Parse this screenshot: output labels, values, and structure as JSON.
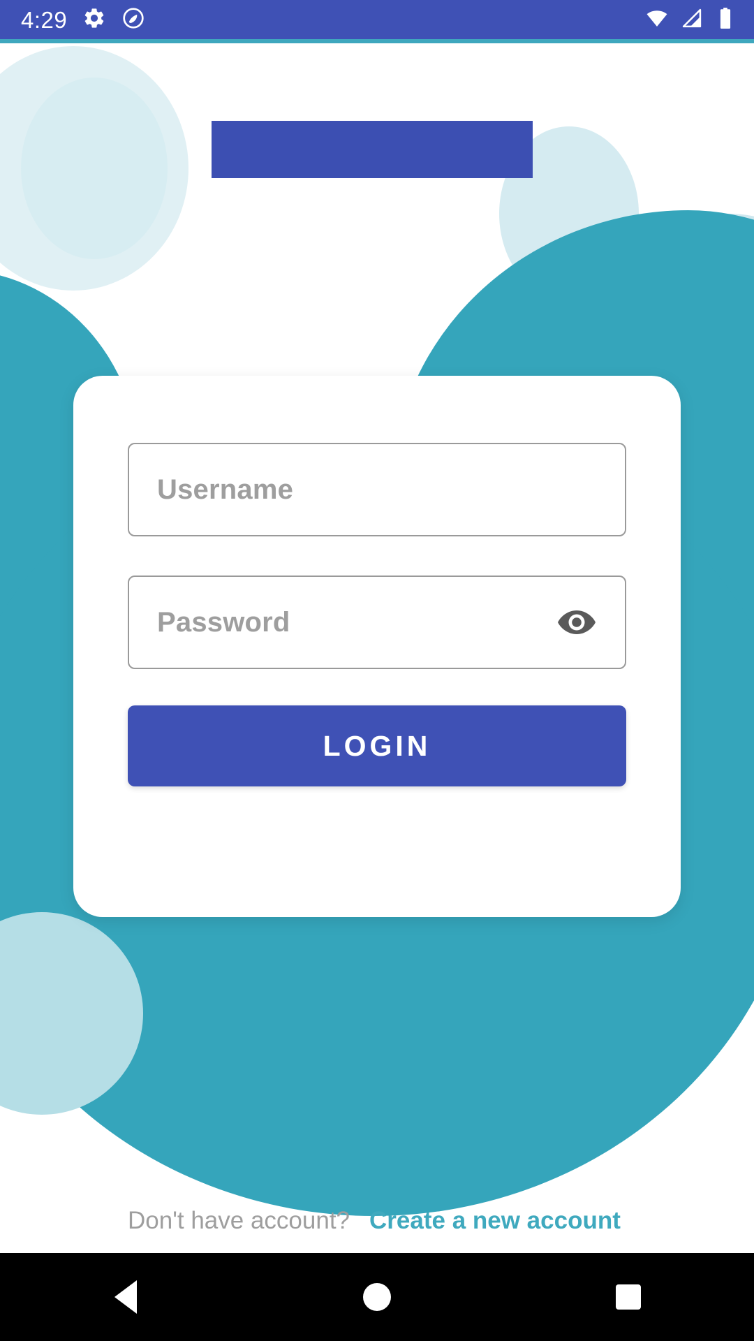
{
  "status_bar": {
    "time": "4:29",
    "left_icons": [
      "gear-icon",
      "dnd-circle-slash-icon"
    ],
    "right_icons": [
      "wifi-icon",
      "cellular-signal-icon",
      "battery-icon"
    ],
    "background_color": "#3F51B5"
  },
  "branding": {
    "logo_placeholder_color": "#3C4FB2",
    "logo_alt": ""
  },
  "theme": {
    "primary_blue": "#3F51B5",
    "teal": "#35A5BB",
    "link_teal": "#3FA9BE",
    "pale_blue": "#D7EDF2",
    "light_blue": "#B5DEE6",
    "field_border": "#9A9A9A",
    "placeholder_text": "#9E9E9E"
  },
  "form": {
    "username": {
      "placeholder": "Username",
      "value": ""
    },
    "password": {
      "placeholder": "Password",
      "value": "",
      "toggle_icon": "eye-icon",
      "visible": false
    },
    "submit_label": "LOGIN"
  },
  "signup": {
    "prompt": "Don't have account?",
    "link_label": "Create a new account"
  },
  "navigation_bar": {
    "back_label": "Back",
    "home_label": "Home",
    "recents_label": "Recents"
  }
}
